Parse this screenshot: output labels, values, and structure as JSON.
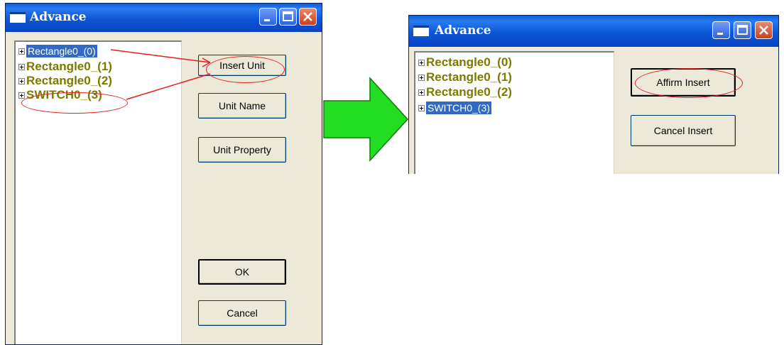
{
  "window_left": {
    "title": "Advance",
    "tree_items": [
      {
        "label": "Rectangle0_(0)"
      },
      {
        "label": "Rectangle0_(1)"
      },
      {
        "label": "Rectangle0_(2)"
      },
      {
        "label": "SWITCH0_(3)"
      }
    ],
    "buttons": {
      "insert_unit": "Insert Unit",
      "unit_name": "Unit Name",
      "unit_property": "Unit Property",
      "ok": "OK",
      "cancel": "Cancel"
    }
  },
  "window_right": {
    "title": "Advance",
    "tree_items": [
      {
        "label": "Rectangle0_(0)"
      },
      {
        "label": "Rectangle0_(1)"
      },
      {
        "label": "Rectangle0_(2)"
      },
      {
        "label": "SWITCH0_(3)"
      }
    ],
    "buttons": {
      "affirm_insert": "Affirm Insert",
      "cancel_insert": "Cancel Insert"
    }
  },
  "colors": {
    "titlebar": "#0a5fd8",
    "selection": "#316ac5",
    "node_text": "#7a7a00",
    "annotation": "#e02020",
    "arrow": "#22dd22",
    "dialog_bg": "#ece9d8"
  },
  "icons": [
    "window-icon",
    "minimize-icon",
    "maximize-icon",
    "close-icon",
    "expand-icon",
    "right-arrow-icon"
  ]
}
